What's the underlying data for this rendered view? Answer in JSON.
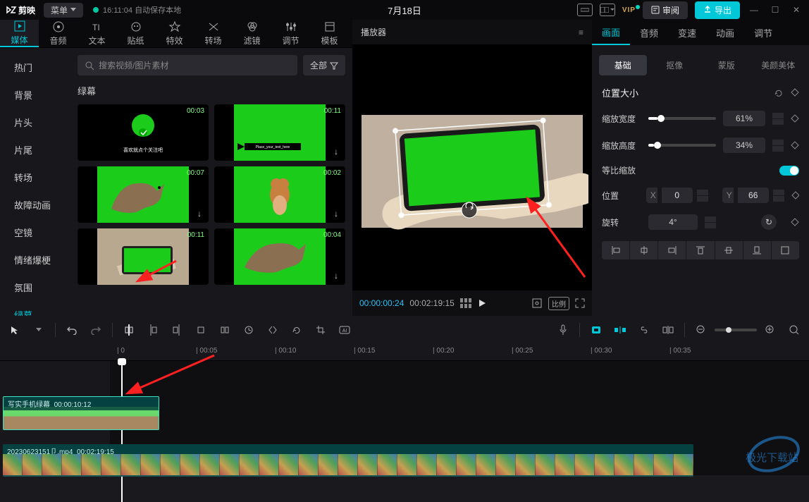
{
  "titlebar": {
    "logo": "剪映",
    "menu": "菜单",
    "status_time": "16:11:04",
    "status_text": "自动保存本地",
    "project_name": "7月18日",
    "vip": "VIP",
    "review": "审阅",
    "export": "导出"
  },
  "media_tabs": [
    {
      "icon": "media",
      "label": "媒体"
    },
    {
      "icon": "audio",
      "label": "音频"
    },
    {
      "icon": "text",
      "label": "文本"
    },
    {
      "icon": "sticker",
      "label": "贴纸"
    },
    {
      "icon": "effect",
      "label": "特效"
    },
    {
      "icon": "transition",
      "label": "转场"
    },
    {
      "icon": "filter",
      "label": "滤镜"
    },
    {
      "icon": "adjust",
      "label": "调节"
    },
    {
      "icon": "template",
      "label": "模板"
    }
  ],
  "sidebar": [
    "热门",
    "背景",
    "片头",
    "片尾",
    "转场",
    "故障动画",
    "空镜",
    "情绪爆梗",
    "氛围",
    "绿幕"
  ],
  "sidebar_active_index": 9,
  "search": {
    "placeholder": "搜索视频/图片素材"
  },
  "filter_label": "全部",
  "section_title": "绿幕",
  "assets": [
    {
      "dur": "00:03",
      "type": "circle-text",
      "text": "喜欢就点个关注吧"
    },
    {
      "dur": "00:11",
      "type": "arrow"
    },
    {
      "dur": "00:07",
      "type": "dino"
    },
    {
      "dur": "00:02",
      "type": "mouse"
    },
    {
      "dur": "00:11",
      "type": "phone"
    },
    {
      "dur": "00:04",
      "type": "dino"
    }
  ],
  "player": {
    "title": "播放器",
    "time_current": "00:00:00:24",
    "time_total": "00:02:19:15",
    "ratio_label": "比例"
  },
  "props": {
    "tabs": [
      "画面",
      "音频",
      "变速",
      "动画",
      "调节"
    ],
    "subtabs": [
      "基础",
      "抠像",
      "蒙版",
      "美颜美体"
    ],
    "section_position": "位置大小",
    "scale_w_label": "缩放宽度",
    "scale_w_value": "61%",
    "scale_h_label": "缩放高度",
    "scale_h_value": "34%",
    "lock_ratio_label": "等比缩放",
    "position_label": "位置",
    "x_label": "X",
    "x_value": "0",
    "y_label": "Y",
    "y_value": "66",
    "rotation_label": "旋转",
    "rotation_value": "4°"
  },
  "timeline": {
    "ticks": [
      "0",
      "00:05",
      "00:10",
      "00:15",
      "00:20",
      "00:25",
      "00:30",
      "00:35"
    ],
    "clip1_name": "写实手机绿幕",
    "clip1_dur": "00:00:10:12",
    "clip2_name": "20230623151卩.mp4",
    "clip2_dur": "00:02:19:15"
  }
}
